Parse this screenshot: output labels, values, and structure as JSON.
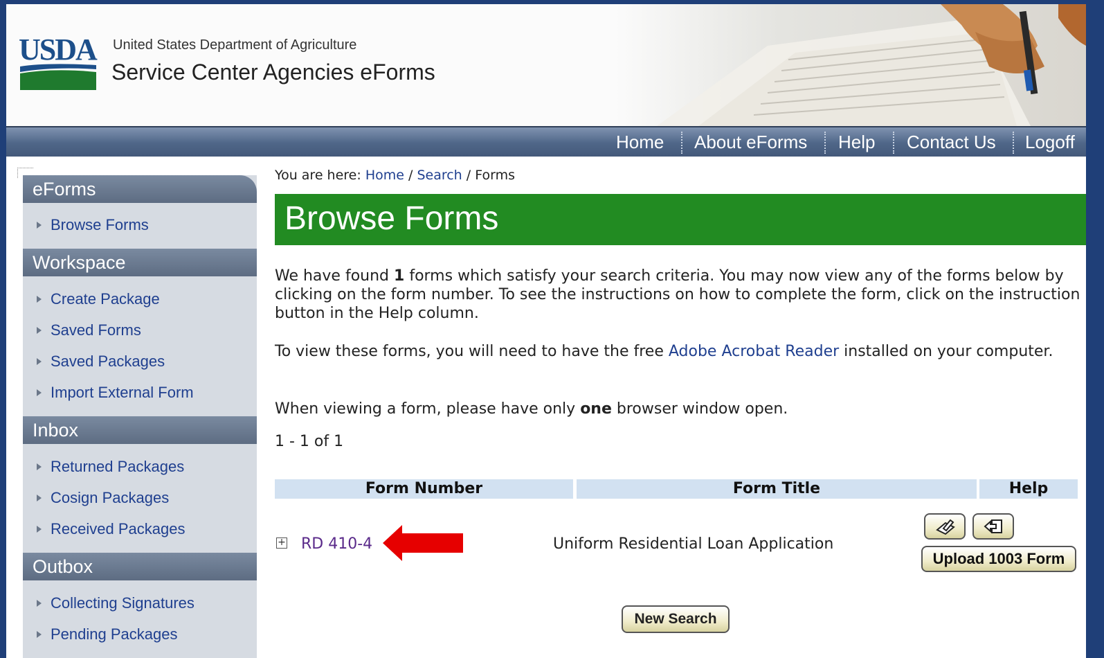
{
  "header": {
    "logo_text": "USDA",
    "department": "United States Department of Agriculture",
    "site_title": "Service Center Agencies eForms"
  },
  "topnav": {
    "items": [
      "Home",
      "About eForms",
      "Help",
      "Contact Us",
      "Logoff"
    ]
  },
  "sidebar": {
    "sections": [
      {
        "heading": "eForms",
        "items": [
          "Browse Forms"
        ]
      },
      {
        "heading": "Workspace",
        "items": [
          "Create Package",
          "Saved Forms",
          "Saved Packages",
          "Import External Form"
        ]
      },
      {
        "heading": "Inbox",
        "items": [
          "Returned Packages",
          "Cosign Packages",
          "Received Packages"
        ]
      },
      {
        "heading": "Outbox",
        "items": [
          "Collecting Signatures",
          "Pending Packages"
        ]
      }
    ]
  },
  "breadcrumb": {
    "prefix": "You are here:",
    "links": [
      "Home",
      "Search"
    ],
    "current": "Forms",
    "separator": "/"
  },
  "main": {
    "title": "Browse Forms",
    "p1_a": "We have found ",
    "p1_count": "1",
    "p1_b": " forms which satisfy your search criteria.  You may now view any of the forms below by clicking on the form number.  To see the instructions on how to complete the form, click on the instruction button in the Help column.",
    "p2_a": "To view these forms, you will need to have the free ",
    "p2_link": "Adobe Acrobat Reader",
    "p2_b": " installed on your computer.",
    "p3_a": "When viewing a form, please have only ",
    "p3_bold": "one",
    "p3_b": " browser window open.",
    "result_count": "1 - 1 of 1"
  },
  "table": {
    "headers": [
      "Form Number",
      "Form Title",
      "Help"
    ],
    "rows": [
      {
        "form_number": "RD 410-4",
        "form_title": "Uniform Residential Loan Application",
        "upload_label": "Upload 1003 Form"
      }
    ]
  },
  "buttons": {
    "new_search": "New Search"
  },
  "colors": {
    "title_bar": "#228b22",
    "nav_bar": "#4f6688",
    "link": "#1f3f8f",
    "arrow": "#e60000"
  }
}
